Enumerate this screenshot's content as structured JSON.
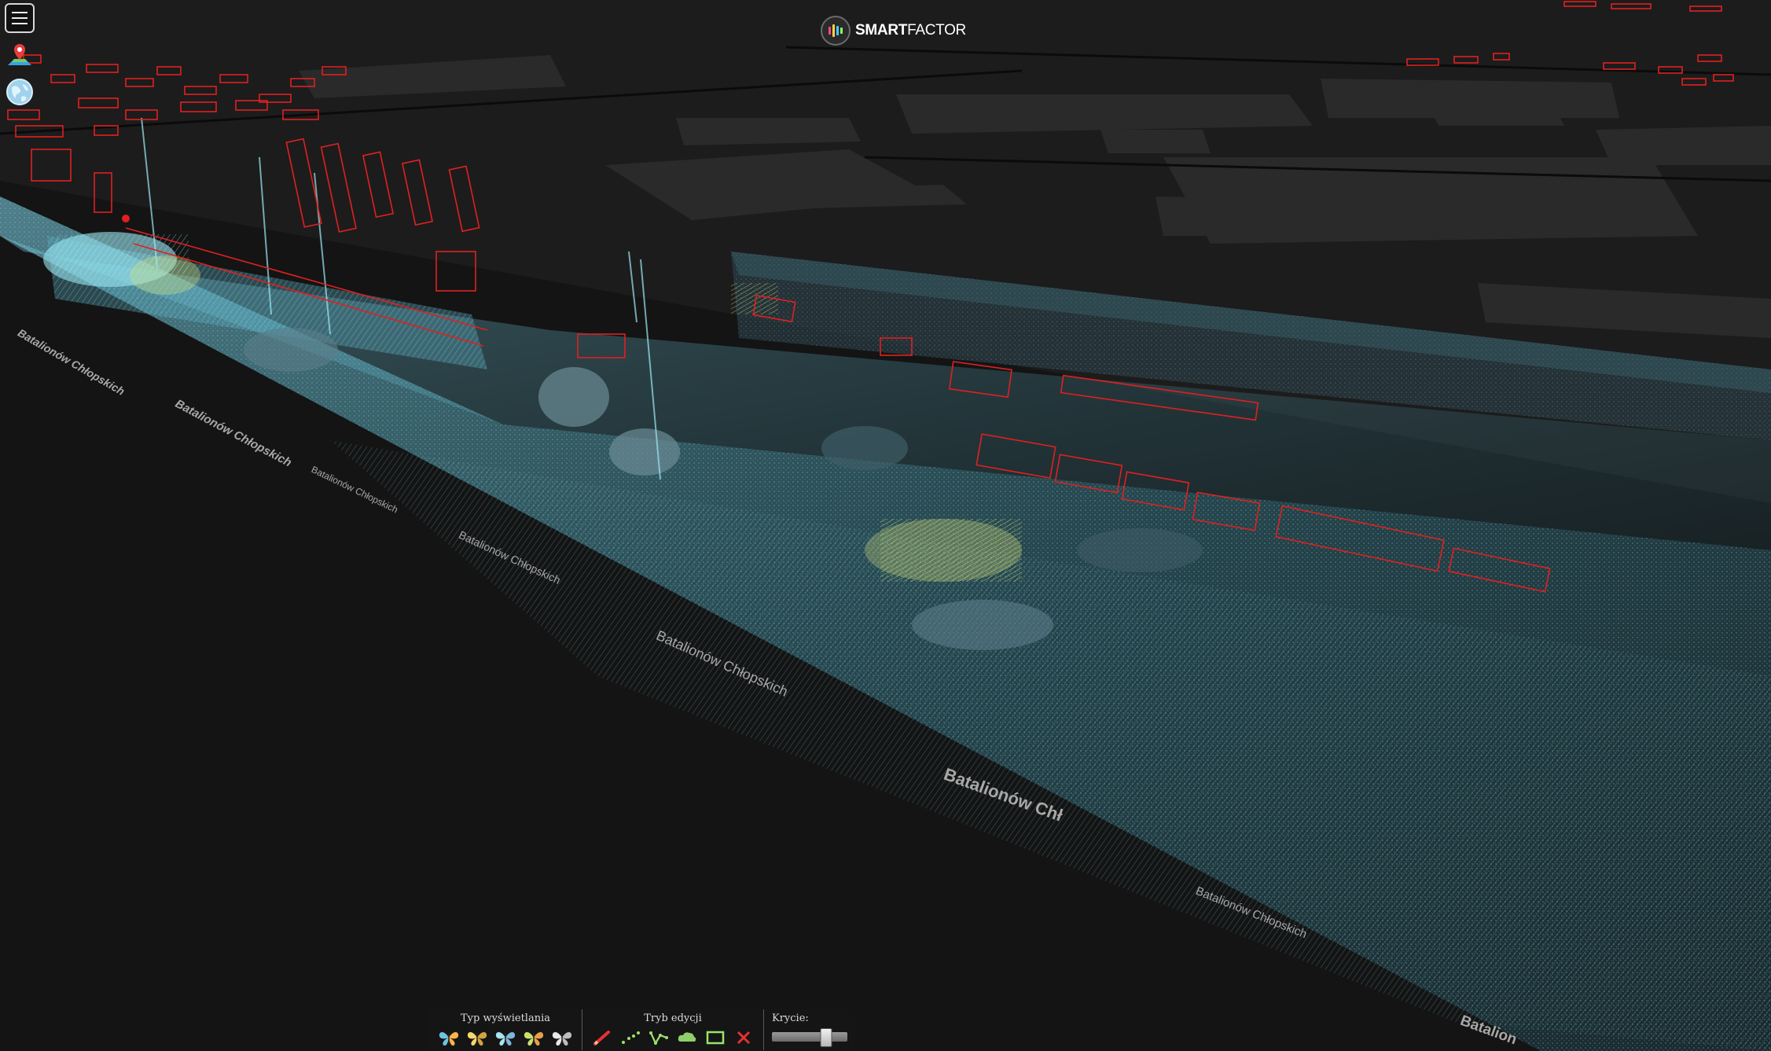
{
  "app": {
    "brand_bold": "SMART",
    "brand_light": "FACTOR"
  },
  "colors": {
    "background": "#141414",
    "point_cloud": "#6ecfe0",
    "highlight": "#d7e27a",
    "annotation": "#e02020",
    "street_label": "#a8a8a8"
  },
  "left_tools": [
    {
      "name": "menu-icon"
    },
    {
      "name": "map-pin-icon"
    },
    {
      "name": "globe-icon"
    }
  ],
  "map": {
    "street_labels": [
      "Batalionów Chłopskich",
      "Batalionów Chłopskich",
      "Batalionów Chłopskich",
      "Batalionów Chłopskich",
      "Batalionów Chłopskich",
      "Batalionów Chł",
      "Batalionów Chłopskich",
      "Batalion"
    ]
  },
  "toolbar": {
    "display_type": {
      "label": "Typ wyświetlania",
      "icons": [
        "butterfly-mode-1-icon",
        "butterfly-mode-2-icon",
        "butterfly-mode-3-icon",
        "butterfly-mode-4-icon",
        "butterfly-mode-5-icon"
      ]
    },
    "edit_mode": {
      "label": "Tryb edycji",
      "icons": [
        "pencil-icon",
        "points-icon",
        "polyline-icon",
        "cloud-shape-icon",
        "rectangle-icon",
        "delete-icon"
      ]
    },
    "opacity": {
      "label": "Krycie:",
      "value": 0.72
    }
  }
}
